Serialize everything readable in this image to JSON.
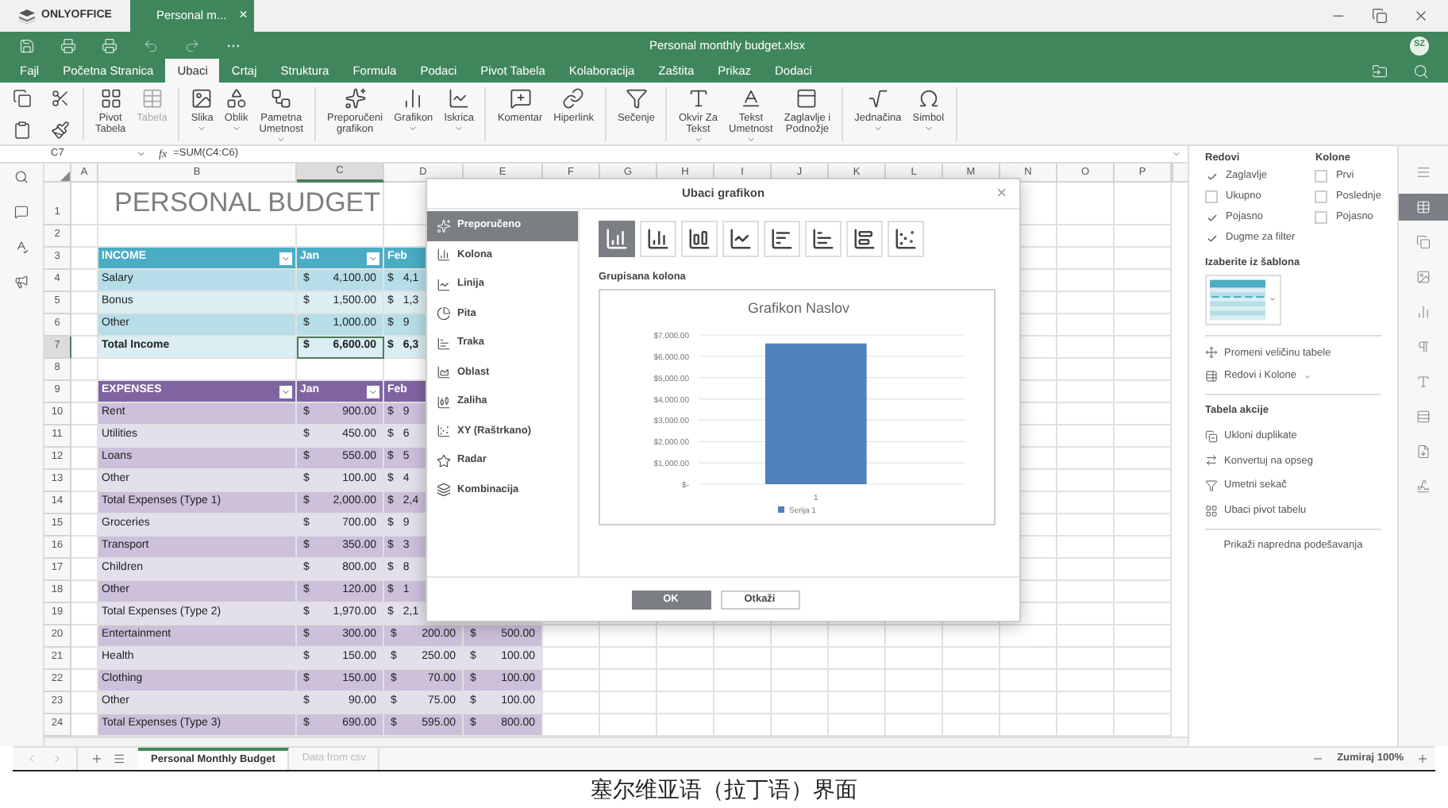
{
  "top_bar": {
    "logo": "ONLYOFFICE",
    "doc_tab": "Personal m...",
    "close": "×"
  },
  "title_bar": {
    "title": "Personal monthly budget.xlsx",
    "avatar": "SZ"
  },
  "menu": [
    {
      "label": "Fajl",
      "selected": false
    },
    {
      "label": "Početna Stranica",
      "selected": false
    },
    {
      "label": "Ubaci",
      "selected": true
    },
    {
      "label": "Crtaj",
      "selected": false
    },
    {
      "label": "Struktura",
      "selected": false
    },
    {
      "label": "Formula",
      "selected": false
    },
    {
      "label": "Podaci",
      "selected": false
    },
    {
      "label": "Pivot Tabela",
      "selected": false
    },
    {
      "label": "Kolaboracija",
      "selected": false
    },
    {
      "label": "Zaštita",
      "selected": false
    },
    {
      "label": "Prikaz",
      "selected": false
    },
    {
      "label": "Dodaci",
      "selected": false
    }
  ],
  "toolbar": [
    {
      "label": "Pivot\nTabela",
      "disabled": false,
      "dropdown": false
    },
    {
      "label": "Tabela",
      "disabled": true,
      "dropdown": false
    },
    {
      "label": "Slika",
      "disabled": false,
      "dropdown": true
    },
    {
      "label": "Oblik",
      "disabled": false,
      "dropdown": true
    },
    {
      "label": "Pametna\nUmetnost",
      "disabled": false,
      "dropdown": true
    },
    {
      "label": "Preporučeni\ngrafikon",
      "disabled": false,
      "dropdown": false
    },
    {
      "label": "Grafikon",
      "disabled": false,
      "dropdown": true
    },
    {
      "label": "Iskrica",
      "disabled": false,
      "dropdown": true
    },
    {
      "label": "Komentar",
      "disabled": false,
      "dropdown": false
    },
    {
      "label": "Hiperlink",
      "disabled": false,
      "dropdown": false
    },
    {
      "label": "Sečenje",
      "disabled": false,
      "dropdown": false
    },
    {
      "label": "Okvir Za\nTekst",
      "disabled": false,
      "dropdown": true
    },
    {
      "label": "Tekst\nUmetnost",
      "disabled": false,
      "dropdown": true
    },
    {
      "label": "Zaglavlje i\nPodnožje",
      "disabled": false,
      "dropdown": false
    },
    {
      "label": "Jednačina",
      "disabled": false,
      "dropdown": true
    },
    {
      "label": "Simbol",
      "disabled": false,
      "dropdown": true
    }
  ],
  "formula_bar": {
    "cell": "C7",
    "fx": "fx",
    "formula": "=SUM(C4:C6)"
  },
  "columns": [
    {
      "label": "A",
      "selected": false
    },
    {
      "label": "B",
      "selected": false
    },
    {
      "label": "C",
      "selected": true
    },
    {
      "label": "D",
      "selected": false
    },
    {
      "label": "E",
      "selected": false
    },
    {
      "label": "F",
      "selected": false
    },
    {
      "label": "G",
      "selected": false
    },
    {
      "label": "H",
      "selected": false
    },
    {
      "label": "I",
      "selected": false
    },
    {
      "label": "J",
      "selected": false
    },
    {
      "label": "K",
      "selected": false
    },
    {
      "label": "L",
      "selected": false
    },
    {
      "label": "M",
      "selected": false
    },
    {
      "label": "N",
      "selected": false
    },
    {
      "label": "O",
      "selected": false
    },
    {
      "label": "P",
      "selected": false
    }
  ],
  "rows": [
    {
      "number": "1",
      "kind": "title",
      "selected": false,
      "label": "PERSONAL BUDGET"
    },
    {
      "number": "2",
      "kind": "blank",
      "selected": false
    },
    {
      "number": "3",
      "kind": "header",
      "color": "#4bacc6",
      "selected": false,
      "label": "INCOME",
      "jan": "Jan",
      "feb": "Feb"
    },
    {
      "number": "4",
      "kind": "data",
      "color": "#b7dee8",
      "bold": false,
      "selected": false,
      "label": "Salary",
      "jan": {
        "symbol": "$",
        "amount": "4,100.00"
      },
      "feb": {
        "symbol": "$",
        "amount": "4,1",
        "partial": true
      }
    },
    {
      "number": "5",
      "kind": "data",
      "color": "#daeef3",
      "bold": false,
      "selected": false,
      "label": "Bonus",
      "jan": {
        "symbol": "$",
        "amount": "1,500.00"
      },
      "feb": {
        "symbol": "$",
        "amount": "1,3",
        "partial": true
      }
    },
    {
      "number": "6",
      "kind": "data",
      "color": "#b7dee8",
      "bold": false,
      "selected": false,
      "label": "Other",
      "jan": {
        "symbol": "$",
        "amount": "1,000.00"
      },
      "feb": {
        "symbol": "$",
        "amount": "9",
        "partial": true
      }
    },
    {
      "number": "7",
      "kind": "data",
      "color": "#daeef3",
      "bold": true,
      "selected": true,
      "label": "Total Income",
      "jan": {
        "symbol": "$",
        "amount": "6,600.00"
      },
      "feb": {
        "symbol": "$",
        "amount": "6,3",
        "partial": true
      }
    },
    {
      "number": "8",
      "kind": "blank",
      "selected": false
    },
    {
      "number": "9",
      "kind": "header",
      "color": "#8064a2",
      "selected": false,
      "label": "EXPENSES",
      "jan": "Jan",
      "feb": "Feb"
    },
    {
      "number": "10",
      "kind": "data",
      "color": "#ccc0da",
      "bold": false,
      "selected": false,
      "label": "Rent",
      "jan": {
        "symbol": "$",
        "amount": "900.00"
      },
      "feb": {
        "symbol": "$",
        "amount": "9",
        "partial": true
      }
    },
    {
      "number": "11",
      "kind": "data",
      "color": "#e4dfec",
      "bold": false,
      "selected": false,
      "label": "Utilities",
      "jan": {
        "symbol": "$",
        "amount": "450.00"
      },
      "feb": {
        "symbol": "$",
        "amount": "6",
        "partial": true
      }
    },
    {
      "number": "12",
      "kind": "data",
      "color": "#ccc0da",
      "bold": false,
      "selected": false,
      "label": "Loans",
      "jan": {
        "symbol": "$",
        "amount": "550.00"
      },
      "feb": {
        "symbol": "$",
        "amount": "5",
        "partial": true
      }
    },
    {
      "number": "13",
      "kind": "data",
      "color": "#e4dfec",
      "bold": false,
      "selected": false,
      "label": "Other",
      "jan": {
        "symbol": "$",
        "amount": "100.00"
      },
      "feb": {
        "symbol": "$",
        "amount": "4",
        "partial": true
      }
    },
    {
      "number": "14",
      "kind": "data",
      "color": "#ccc0da",
      "bold": false,
      "selected": false,
      "label": "Total Expenses (Type 1)",
      "jan": {
        "symbol": "$",
        "amount": "2,000.00"
      },
      "feb": {
        "symbol": "$",
        "amount": "2,4",
        "partial": true
      }
    },
    {
      "number": "15",
      "kind": "data",
      "color": "#e4dfec",
      "bold": false,
      "selected": false,
      "label": "Groceries",
      "jan": {
        "symbol": "$",
        "amount": "700.00"
      },
      "feb": {
        "symbol": "$",
        "amount": "9",
        "partial": true
      }
    },
    {
      "number": "16",
      "kind": "data",
      "color": "#ccc0da",
      "bold": false,
      "selected": false,
      "label": "Transport",
      "jan": {
        "symbol": "$",
        "amount": "350.00"
      },
      "feb": {
        "symbol": "$",
        "amount": "3",
        "partial": true
      }
    },
    {
      "number": "17",
      "kind": "data",
      "color": "#e4dfec",
      "bold": false,
      "selected": false,
      "label": "Children",
      "jan": {
        "symbol": "$",
        "amount": "800.00"
      },
      "feb": {
        "symbol": "$",
        "amount": "8",
        "partial": true
      }
    },
    {
      "number": "18",
      "kind": "data",
      "color": "#ccc0da",
      "bold": false,
      "selected": false,
      "label": "Other",
      "jan": {
        "symbol": "$",
        "amount": "120.00"
      },
      "feb": {
        "symbol": "$",
        "amount": "1",
        "partial": true
      }
    },
    {
      "number": "19",
      "kind": "data",
      "color": "#e4dfec",
      "bold": false,
      "selected": false,
      "label": "Total Expenses (Type 2)",
      "jan": {
        "symbol": "$",
        "amount": "1,970.00"
      },
      "feb": {
        "symbol": "$",
        "amount": "2,1",
        "partial": true
      }
    },
    {
      "number": "20",
      "kind": "data",
      "color": "#ccc0da",
      "bold": false,
      "selected": false,
      "label": "Entertainment",
      "jan": {
        "symbol": "$",
        "amount": "300.00"
      },
      "feb": {
        "symbol": "$",
        "amount": "200.00",
        "partial": false
      },
      "mar": {
        "symbol": "$",
        "amount": "500.00"
      }
    },
    {
      "number": "21",
      "kind": "data",
      "color": "#e4dfec",
      "bold": false,
      "selected": false,
      "label": "Health",
      "jan": {
        "symbol": "$",
        "amount": "150.00"
      },
      "feb": {
        "symbol": "$",
        "amount": "250.00",
        "partial": false
      },
      "mar": {
        "symbol": "$",
        "amount": "100.00"
      }
    },
    {
      "number": "22",
      "kind": "data",
      "color": "#ccc0da",
      "bold": false,
      "selected": false,
      "label": "Clothing",
      "jan": {
        "symbol": "$",
        "amount": "150.00"
      },
      "feb": {
        "symbol": "$",
        "amount": "70.00",
        "partial": false
      },
      "mar": {
        "symbol": "$",
        "amount": "100.00"
      }
    },
    {
      "number": "23",
      "kind": "data",
      "color": "#e4dfec",
      "bold": false,
      "selected": false,
      "label": "Other",
      "jan": {
        "symbol": "$",
        "amount": "90.00"
      },
      "feb": {
        "symbol": "$",
        "amount": "75.00",
        "partial": false
      },
      "mar": {
        "symbol": "$",
        "amount": "100.00"
      }
    },
    {
      "number": "24",
      "kind": "data",
      "color": "#ccc0da",
      "bold": false,
      "selected": false,
      "label": "Total Expenses (Type 3)",
      "jan": {
        "symbol": "$",
        "amount": "690.00"
      },
      "feb": {
        "symbol": "$",
        "amount": "595.00",
        "partial": false
      },
      "mar": {
        "symbol": "$",
        "amount": "800.00"
      }
    }
  ],
  "dialog": {
    "title": "Ubaci grafikon",
    "close": "×",
    "types": [
      {
        "label": "Preporučeno",
        "selected": true
      },
      {
        "label": "Kolona",
        "selected": false
      },
      {
        "label": "Linija",
        "selected": false
      },
      {
        "label": "Pita",
        "selected": false
      },
      {
        "label": "Traka",
        "selected": false
      },
      {
        "label": "Oblast",
        "selected": false
      },
      {
        "label": "Zaliha",
        "selected": false
      },
      {
        "label": "XY (Raštrkano)",
        "selected": false
      },
      {
        "label": "Radar",
        "selected": false
      },
      {
        "label": "Kombinacija",
        "selected": false
      }
    ],
    "styles": [
      {
        "selected": true
      },
      {
        "selected": false
      },
      {
        "selected": false
      },
      {
        "selected": false
      },
      {
        "selected": false
      },
      {
        "selected": false
      },
      {
        "selected": false
      },
      {
        "selected": false
      }
    ],
    "style_name": "Grupisana kolona",
    "chart_data": {
      "type": "bar",
      "grid": true,
      "title": "Grafikon Naslov",
      "categories": [
        "1"
      ],
      "series": [
        {
          "name": "Serija 1",
          "color": "#4f81bd",
          "values": [
            6600
          ]
        }
      ],
      "ylim": [
        0,
        7000
      ],
      "yticks": [
        {
          "value": 0,
          "label": "$-"
        },
        {
          "value": 1000,
          "label": "$1,000.00"
        },
        {
          "value": 2000,
          "label": "$2,000.00"
        },
        {
          "value": 3000,
          "label": "$3,000.00"
        },
        {
          "value": 4000,
          "label": "$4,000.00"
        },
        {
          "value": 5000,
          "label": "$5,000.00"
        },
        {
          "value": 6000,
          "label": "$6,000.00"
        },
        {
          "value": 7000,
          "label": "$7,000.00"
        }
      ]
    },
    "ok": "OK",
    "cancel": "Otkaži"
  },
  "panel": {
    "rows_title": "Redovi",
    "cols_title": "Kolone",
    "row_options": [
      {
        "label": "Zaglavlje",
        "checked": true
      },
      {
        "label": "Ukupno",
        "checked": false
      },
      {
        "label": "Pojasno",
        "checked": true
      }
    ],
    "col_options": [
      {
        "label": "Prvi",
        "checked": false
      },
      {
        "label": "Poslednje",
        "checked": false
      },
      {
        "label": "Pojasno",
        "checked": false
      }
    ],
    "filter": {
      "label": "Dugme za filter",
      "checked": true
    },
    "template_title": "Izaberite iz šablona",
    "resize": "Promeni veličinu tabele",
    "rows_cols": "Redovi i Kolone",
    "actions_title": "Tabela akcije",
    "actions": [
      "Ukloni duplikate",
      "Konvertuj na opseg",
      "Umetni sekač",
      "Ubaci pivot tabelu"
    ],
    "advanced": "Prikaži napredna podešavanja"
  },
  "right_bar": [
    {
      "selected": false
    },
    {
      "selected": true
    },
    {
      "selected": false
    },
    {
      "selected": false
    },
    {
      "selected": false
    },
    {
      "selected": false
    },
    {
      "selected": false
    },
    {
      "selected": false
    },
    {
      "selected": false
    },
    {
      "selected": false
    }
  ],
  "sheet_tabs": [
    {
      "label": "Personal Monthly Budget",
      "selected": true
    },
    {
      "label": "Data from csv",
      "selected": false
    }
  ],
  "zoom": "Zumiraj 100%",
  "caption": "塞尔维亚语（拉丁语）界面"
}
